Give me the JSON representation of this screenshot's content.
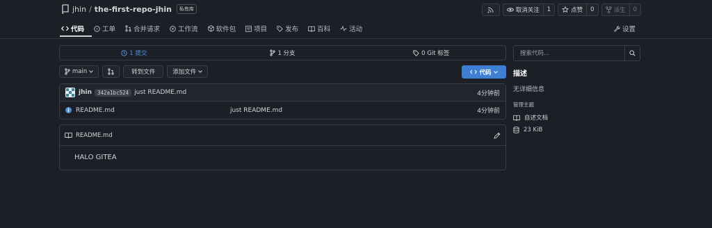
{
  "repo": {
    "owner": "jhin",
    "separator": "/",
    "name": "the-first-repo-jhin",
    "visibility": "私有库",
    "icon": "repo-icon"
  },
  "actions": {
    "rss": {
      "icon": "rss-icon"
    },
    "watch": {
      "label": "取消关注",
      "count": "1",
      "icon": "eye-icon"
    },
    "star": {
      "label": "点赞",
      "count": "0",
      "icon": "star-icon"
    },
    "fork": {
      "label": "派生",
      "count": "0",
      "icon": "fork-icon"
    }
  },
  "tabs": [
    {
      "label": "代码",
      "icon": "code-icon",
      "active": true
    },
    {
      "label": "工单",
      "icon": "issue-icon"
    },
    {
      "label": "合并请求",
      "icon": "pull-request-icon"
    },
    {
      "label": "工作流",
      "icon": "play-icon"
    },
    {
      "label": "软件包",
      "icon": "package-icon"
    },
    {
      "label": "项目",
      "icon": "project-icon"
    },
    {
      "label": "发布",
      "icon": "tag-icon"
    },
    {
      "label": "百科",
      "icon": "book-icon"
    },
    {
      "label": "活动",
      "icon": "pulse-icon"
    }
  ],
  "settings": {
    "label": "设置",
    "icon": "tools-icon"
  },
  "stats": {
    "commits": "1 提交",
    "branches": "1 分支",
    "tags": "0 Git 标签"
  },
  "toolbar": {
    "branch": "main",
    "goto_file": "转到文件",
    "add_file": "添加文件",
    "code": "代码"
  },
  "latest_commit": {
    "author": "jhin",
    "sha": "342a1bc524",
    "message": "just README.md",
    "time": "4分钟前"
  },
  "files": [
    {
      "name": "README.md",
      "message": "just README.md",
      "time": "4分钟前",
      "icon": "info-file-icon"
    }
  ],
  "readme": {
    "filename": "README.md",
    "content": "HALO GITEA"
  },
  "sidebar": {
    "search_placeholder": "搜索代码...",
    "title": "描述",
    "description": "无详细信息",
    "topics_link": "管理主题",
    "readme_label": "自述文档",
    "size": "23 KiB"
  },
  "colors": {
    "accent": "#3d7fd3",
    "background": "#1c1f25",
    "border": "#3a3e45"
  }
}
